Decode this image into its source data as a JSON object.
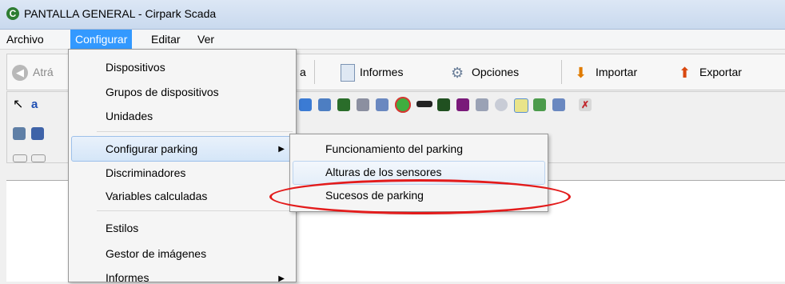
{
  "window": {
    "title": "PANTALLA GENERAL - Cirpark Scada",
    "logo_letter": "C"
  },
  "menubar": [
    {
      "label": "Archivo"
    },
    {
      "label": "Configurar"
    },
    {
      "label": "Editar"
    },
    {
      "label": "Ver"
    }
  ],
  "toolbar": {
    "back_label": "Atrá",
    "partial_label": "a",
    "informes_label": "Informes",
    "opciones_label": "Opciones",
    "importar_label": "Importar",
    "exportar_label": "Exportar"
  },
  "configurar_menu": {
    "items": [
      {
        "label": "Dispositivos"
      },
      {
        "label": "Grupos de dispositivos"
      },
      {
        "label": "Unidades"
      },
      {
        "label": "Configurar parking"
      },
      {
        "label": "Discriminadores"
      },
      {
        "label": "Variables calculadas"
      },
      {
        "label": "Estilos"
      },
      {
        "label": "Gestor de imágenes"
      },
      {
        "label": "Informes"
      }
    ]
  },
  "parking_submenu": {
    "items": [
      {
        "label": "Funcionamiento del parking"
      },
      {
        "label": "Alturas de los sensores"
      },
      {
        "label": "Sucesos de parking"
      }
    ]
  },
  "colors": {
    "menu_active": "#3399ff",
    "annotation_ellipse": "#e31b1b"
  },
  "icons": [
    "app-logo-icon",
    "back-arrow-icon",
    "informes-icon",
    "opciones-gears-icon",
    "importar-icon",
    "exportar-icon",
    "pointer-icon",
    "text-tool-icon",
    "save-icon",
    "chevron-right-icon"
  ]
}
